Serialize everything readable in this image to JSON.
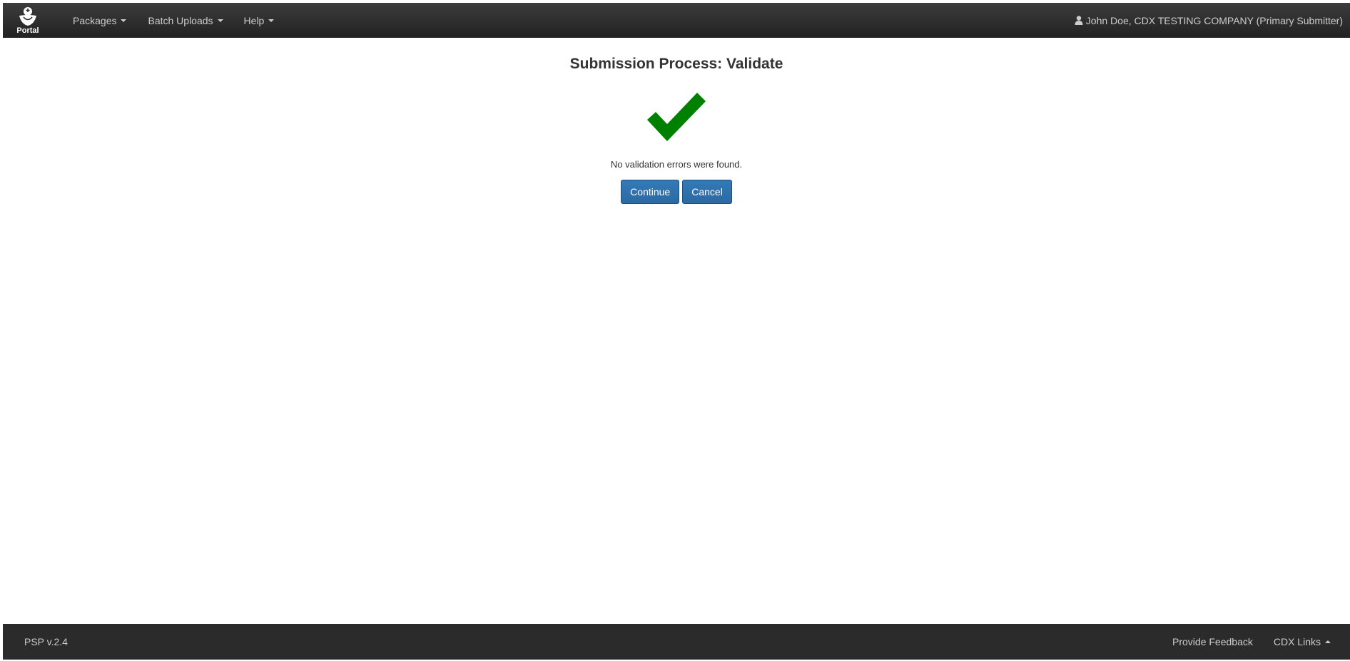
{
  "navbar": {
    "brand_label": "Portal",
    "menus": [
      {
        "label": "Packages"
      },
      {
        "label": "Batch Uploads"
      },
      {
        "label": "Help"
      }
    ],
    "user_label": "John Doe, CDX TESTING COMPANY (Primary Submitter)"
  },
  "main": {
    "title": "Submission Process: Validate",
    "status_icon": "green-checkmark",
    "status_color": "#008000",
    "message": "No validation errors were found.",
    "continue_label": "Continue",
    "cancel_label": "Cancel"
  },
  "footer": {
    "version": "PSP  v.2.4",
    "feedback_label": "Provide Feedback",
    "cdx_links_label": "CDX Links"
  },
  "colors": {
    "navbar_bg": "#2b2b2b",
    "nav_text": "#cccccc",
    "button_primary": "#337ab7"
  }
}
